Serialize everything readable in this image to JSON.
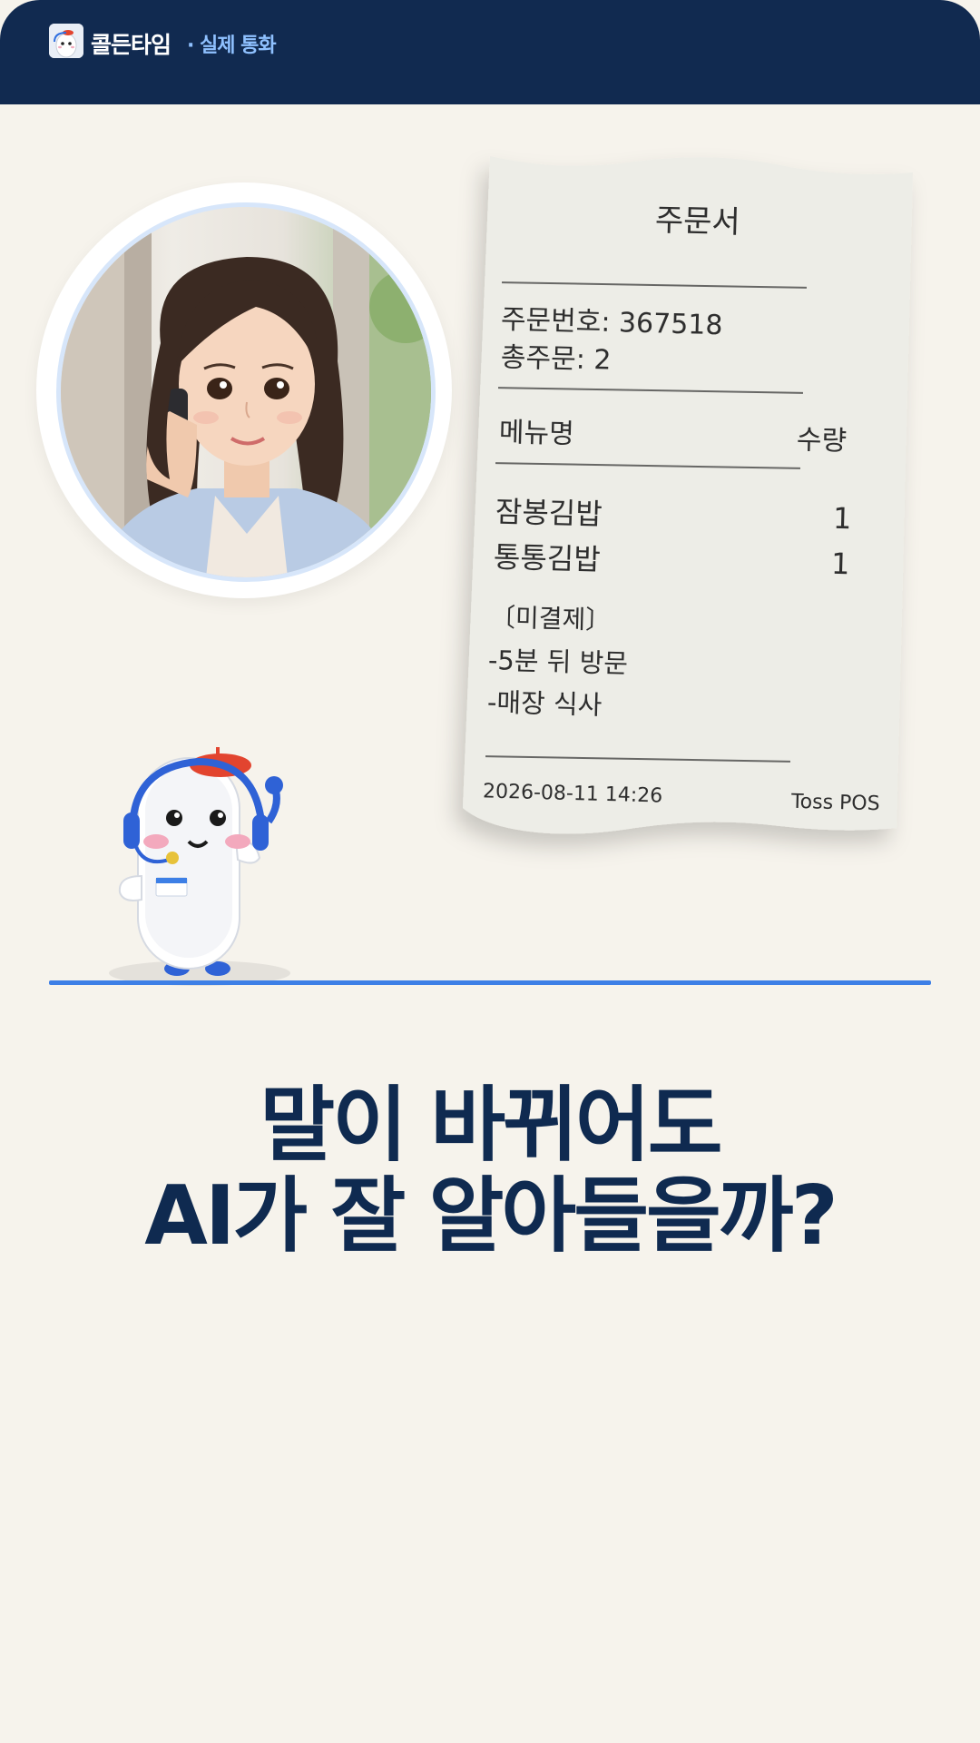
{
  "header": {
    "brand_name": "콜든타임",
    "subtitle": "· 실제 통화"
  },
  "receipt": {
    "title": "주문서",
    "order_number": "주문번호: 367518",
    "total_orders": "총주문: 2",
    "col_menu": "메뉴명",
    "col_qty": "수량",
    "items": [
      {
        "name": "잠봉김밥",
        "qty": "1"
      },
      {
        "name": "통통김밥",
        "qty": "1"
      }
    ],
    "note_status": "〔미결제〕",
    "note_visit": "-5분 뒤 방문",
    "note_dine": "-매장 식사",
    "datetime": "2026-08-11 14:26",
    "pos_name": "Toss POS"
  },
  "headline": {
    "line1": "말이 바뀌어도",
    "line2": "AI가 잘 알아들을까?"
  }
}
